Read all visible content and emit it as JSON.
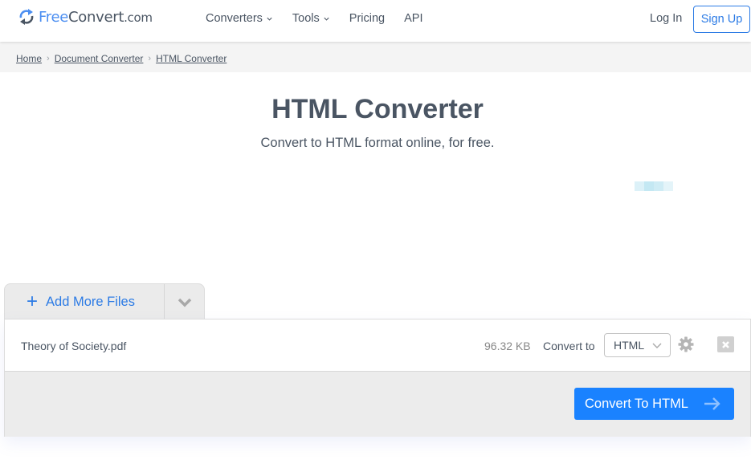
{
  "header": {
    "logo": {
      "part1": "Free",
      "part2": "Convert",
      "part3": ".com"
    },
    "nav": [
      {
        "label": "Converters",
        "has_dropdown": true
      },
      {
        "label": "Tools",
        "has_dropdown": true
      },
      {
        "label": "Pricing",
        "has_dropdown": false
      },
      {
        "label": "API",
        "has_dropdown": false
      }
    ],
    "login_label": "Log In",
    "signup_label": "Sign Up"
  },
  "breadcrumb": [
    "Home",
    "Document Converter",
    "HTML Converter"
  ],
  "main": {
    "title": "HTML Converter",
    "subtitle": "Convert to HTML format online, for free."
  },
  "uploader": {
    "add_files_label": "Add More Files",
    "files": [
      {
        "name": "Theory of Society.pdf",
        "size": "96.32 KB",
        "convert_to_label": "Convert to",
        "format": "HTML"
      }
    ],
    "convert_button_label": "Convert To HTML"
  },
  "colors": {
    "brand_blue": "#2c7be5",
    "button_blue": "#1a82ff",
    "text": "#4a5563"
  }
}
